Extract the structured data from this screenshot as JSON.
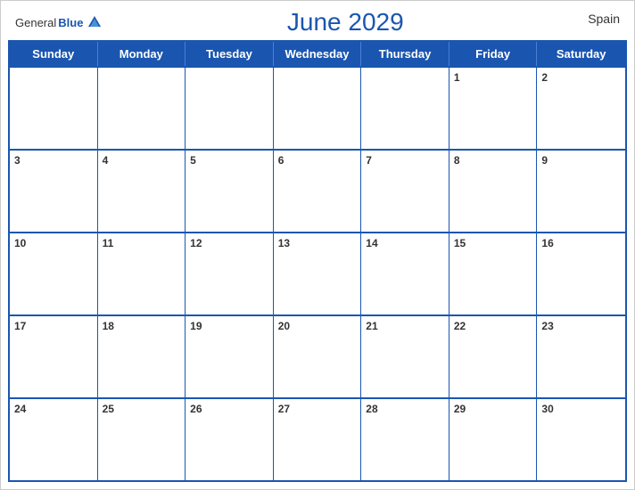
{
  "header": {
    "logo_general": "General",
    "logo_blue": "Blue",
    "title": "June 2029",
    "country": "Spain"
  },
  "days_of_week": [
    "Sunday",
    "Monday",
    "Tuesday",
    "Wednesday",
    "Thursday",
    "Friday",
    "Saturday"
  ],
  "weeks": [
    [
      {
        "date": "",
        "empty": true
      },
      {
        "date": "",
        "empty": true
      },
      {
        "date": "",
        "empty": true
      },
      {
        "date": "",
        "empty": true
      },
      {
        "date": "",
        "empty": true
      },
      {
        "date": "1",
        "empty": false
      },
      {
        "date": "2",
        "empty": false
      }
    ],
    [
      {
        "date": "3",
        "empty": false
      },
      {
        "date": "4",
        "empty": false
      },
      {
        "date": "5",
        "empty": false
      },
      {
        "date": "6",
        "empty": false
      },
      {
        "date": "7",
        "empty": false
      },
      {
        "date": "8",
        "empty": false
      },
      {
        "date": "9",
        "empty": false
      }
    ],
    [
      {
        "date": "10",
        "empty": false
      },
      {
        "date": "11",
        "empty": false
      },
      {
        "date": "12",
        "empty": false
      },
      {
        "date": "13",
        "empty": false
      },
      {
        "date": "14",
        "empty": false
      },
      {
        "date": "15",
        "empty": false
      },
      {
        "date": "16",
        "empty": false
      }
    ],
    [
      {
        "date": "17",
        "empty": false
      },
      {
        "date": "18",
        "empty": false
      },
      {
        "date": "19",
        "empty": false
      },
      {
        "date": "20",
        "empty": false
      },
      {
        "date": "21",
        "empty": false
      },
      {
        "date": "22",
        "empty": false
      },
      {
        "date": "23",
        "empty": false
      }
    ],
    [
      {
        "date": "24",
        "empty": false
      },
      {
        "date": "25",
        "empty": false
      },
      {
        "date": "26",
        "empty": false
      },
      {
        "date": "27",
        "empty": false
      },
      {
        "date": "28",
        "empty": false
      },
      {
        "date": "29",
        "empty": false
      },
      {
        "date": "30",
        "empty": false
      }
    ]
  ]
}
